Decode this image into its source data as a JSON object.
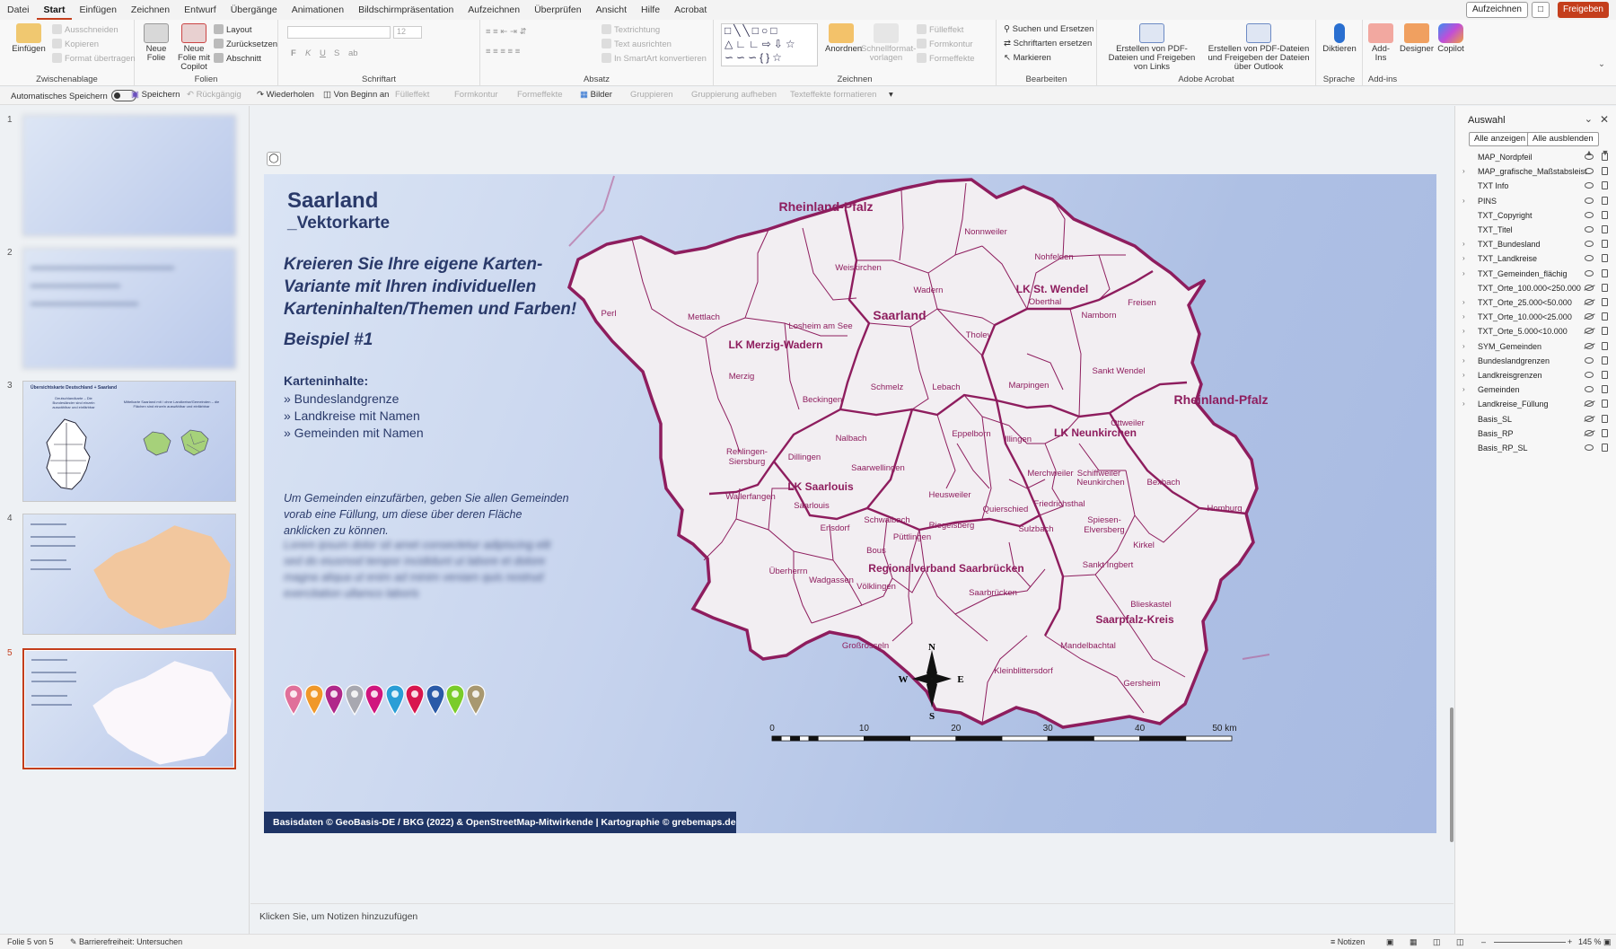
{
  "menubar": {
    "items": [
      "Datei",
      "Start",
      "Einfügen",
      "Zeichnen",
      "Entwurf",
      "Übergänge",
      "Animationen",
      "Bildschirmpräsentation",
      "Aufzeichnen",
      "Überprüfen",
      "Ansicht",
      "Hilfe",
      "Acrobat"
    ],
    "active": "Start",
    "record_label": "Aufzeichnen",
    "share_label": "Freigeben"
  },
  "ribbon": {
    "clipboard": {
      "name": "Zwischenablage",
      "paste": "Einfügen",
      "cut": "Ausschneiden",
      "copy": "Kopieren",
      "format_painter": "Format übertragen"
    },
    "slides": {
      "name": "Folien",
      "new_slide": "Neue Folie",
      "new_copilot": "Neue Folie mit Copilot",
      "layout": "Layout",
      "reset": "Zurücksetzen",
      "section": "Abschnitt"
    },
    "font": {
      "name": "Schriftart",
      "size": "12",
      "bold": "F",
      "italic": "K",
      "underline": "U",
      "strike": "S",
      "shadow": "ab"
    },
    "paragraph": {
      "name": "Absatz",
      "text_direction": "Textrichtung",
      "align_text": "Text ausrichten",
      "smartart": "In SmartArt konvertieren"
    },
    "drawing": {
      "name": "Zeichnen",
      "arrange": "Anordnen",
      "quick_styles": "Schnellformat-vorlagen",
      "fill": "Fülleffekt",
      "outline": "Formkontur",
      "effects": "Formeffekte"
    },
    "editing": {
      "name": "Bearbeiten",
      "find": "Suchen und Ersetzen",
      "replace_fonts": "Schriftarten ersetzen",
      "select": "Markieren"
    },
    "acrobat": {
      "name": "Adobe Acrobat",
      "create_pdf": "Erstellen von PDF-Dateien und Freigeben von Links",
      "create_outlook": "Erstellen von PDF-Dateien und Freigeben der Dateien über Outlook"
    },
    "voice": {
      "name": "Sprache",
      "dictate": "Diktieren"
    },
    "addins": {
      "name": "Add-ins",
      "addins": "Add-Ins",
      "designer": "Designer",
      "copilot": "Copilot"
    }
  },
  "qat": {
    "autosave": "Automatisches Speichern",
    "save": "Speichern",
    "undo": "Rückgängig",
    "redo": "Wiederholen",
    "from_start": "Von Beginn an",
    "fill": "Fülleffekt",
    "outline": "Formkontur",
    "effects": "Formeffekte",
    "pictures": "Bilder",
    "group": "Gruppieren",
    "ungroup": "Gruppierung aufheben",
    "text_effects": "Texteffekte formatieren"
  },
  "thumbnails": {
    "numbers": [
      "1",
      "2",
      "3",
      "4",
      "5"
    ],
    "slide3_title": "Übersichtskarte Deutschland + Saarland",
    "slide3_left": "Deutschlandkarte – Die Bundesländer sind einzeln auswählbar und einfärbbar",
    "slide3_right": "Mittelkarte Saarland mit / ohne Landkreise/Gemeinden – die Flächen sind einzeln auswählbar und einfärbbar"
  },
  "slide": {
    "title": "Saarland",
    "subtitle": "_Vektorkarte",
    "tagline": "Kreieren Sie Ihre eigene Karten-Variante mit Ihren individuellen Karteninhalten/Themen und Farben!",
    "example": "Beispiel #1",
    "contents_heading": "Karteninhalte:",
    "bullets": [
      "» Bundeslandgrenze",
      "» Landkreise mit Namen",
      "» Gemeinden mit Namen"
    ],
    "note": "Um Gemeinden einzufärben, geben Sie allen Gemeinden vorab eine Füllung, um diese über deren Fläche anklicken zu können.",
    "note_blurred": "Lorem ipsum dolor sit amet consectetur adipiscing elit sed do eiusmod tempor incididunt ut labore et dolore magna aliqua ut enim ad minim veniam quis nostrud exercitation ullamco laboris",
    "footer": "Basisdaten © GeoBasis-DE / BKG (2022) & OpenStreetMap-Mitwirkende | Kartographie © grebemaps.de",
    "pin_colors": [
      "#e0709a",
      "#f0982a",
      "#b0288a",
      "#a8a8b0",
      "#d0167e",
      "#2a9ed6",
      "#d8164e",
      "#2a5aa8",
      "#7acc2a",
      "#a89870"
    ]
  },
  "map": {
    "border_color": "#8e1d5e",
    "district_color": "#8e1d5e",
    "fill_color": "#f2eef2",
    "state_label": "Saarland",
    "neighbor_labels": [
      "Rheinland-Pfalz",
      "Rheinland-Pfalz"
    ],
    "district_labels": [
      "LK Merzig-Wadern",
      "LK St. Wendel",
      "LK Neunkirchen",
      "LK Saarlouis",
      "Regionalverband Saarbrücken",
      "Saarpfalz-Kreis"
    ],
    "municipalities": [
      "Perl",
      "Mettlach",
      "Weiskirchen",
      "Nonnweiler",
      "Nohfelden",
      "Wadern",
      "Losheim am See",
      "Oberthal",
      "Namborn",
      "Freisen",
      "Tholey",
      "Merzig",
      "Beckingen",
      "Schmelz",
      "Lebach",
      "Marpingen",
      "Sankt Wendel",
      "Eppelborn",
      "Illingen",
      "Ottweiler",
      "Nalbach",
      "Dillingen",
      "Rehlingen-Siersburg",
      "Saarwellingen",
      "Merchweiler",
      "Schiffweiler",
      "Neunkirchen",
      "Bexbach",
      "Wallerfangen",
      "Saarlouis",
      "Heusweiler",
      "Quierschied",
      "Friedrichsthal",
      "Schwalbach",
      "Ensdorf",
      "Riegelsberg",
      "Sulzbach",
      "Spiesen-Elversberg",
      "Homburg",
      "Püttlingen",
      "Bous",
      "Überherrn",
      "Wadgassen",
      "Völklingen",
      "Saarbrücken",
      "Sankt Ingbert",
      "Kirkel",
      "Großrosseln",
      "Blieskastel",
      "Mandelbachtal",
      "Kleinblittersdorf",
      "Gersheim"
    ],
    "compass": {
      "n": "N",
      "s": "S",
      "e": "E",
      "w": "W"
    },
    "scale_labels": [
      "0",
      "10",
      "20",
      "30",
      "40",
      "50 km"
    ]
  },
  "selection_pane": {
    "title": "Auswahl",
    "show_all": "Alle anzeigen",
    "hide_all": "Alle ausblenden",
    "layers": [
      {
        "name": "MAP_Nordpfeil",
        "expand": false,
        "visible": true
      },
      {
        "name": "MAP_grafische_Maßstabsleiste",
        "expand": true,
        "visible": true
      },
      {
        "name": "TXT Info",
        "expand": false,
        "visible": true
      },
      {
        "name": "PINS",
        "expand": true,
        "visible": true
      },
      {
        "name": "TXT_Copyright",
        "expand": false,
        "visible": true
      },
      {
        "name": "TXT_Titel",
        "expand": false,
        "visible": true
      },
      {
        "name": "TXT_Bundesland",
        "expand": true,
        "visible": true
      },
      {
        "name": "TXT_Landkreise",
        "expand": true,
        "visible": true
      },
      {
        "name": "TXT_Gemeinden_flächig",
        "expand": true,
        "visible": true
      },
      {
        "name": "TXT_Orte_100.000<250.000",
        "expand": false,
        "visible": false
      },
      {
        "name": "TXT_Orte_25.000<50.000",
        "expand": true,
        "visible": false
      },
      {
        "name": "TXT_Orte_10.000<25.000",
        "expand": true,
        "visible": false
      },
      {
        "name": "TXT_Orte_5.000<10.000",
        "expand": true,
        "visible": false
      },
      {
        "name": "SYM_Gemeinden",
        "expand": true,
        "visible": false
      },
      {
        "name": "Bundeslandgrenzen",
        "expand": true,
        "visible": true
      },
      {
        "name": "Landkreisgrenzen",
        "expand": true,
        "visible": true
      },
      {
        "name": "Gemeinden",
        "expand": true,
        "visible": true
      },
      {
        "name": "Landkreise_Füllung",
        "expand": true,
        "visible": false
      },
      {
        "name": "Basis_SL",
        "expand": false,
        "visible": false
      },
      {
        "name": "Basis_RP",
        "expand": false,
        "visible": false
      },
      {
        "name": "Basis_RP_SL",
        "expand": false,
        "visible": true
      }
    ]
  },
  "notes": {
    "placeholder": "Klicken Sie, um Notizen hinzuzufügen"
  },
  "status": {
    "slide": "Folie 5 von 5",
    "accessibility": "Barrierefreiheit: Untersuchen",
    "notes": "Notizen",
    "zoom": "145 %"
  }
}
